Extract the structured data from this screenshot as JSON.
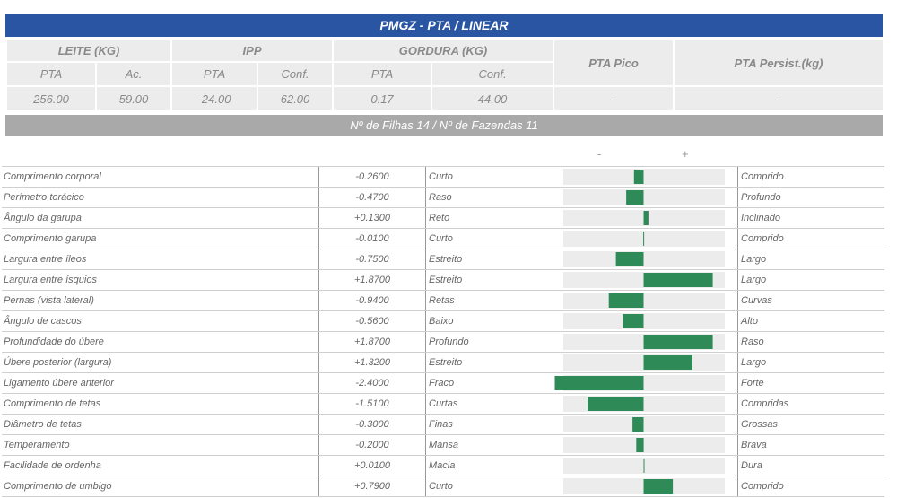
{
  "header": {
    "title": "PMGZ - PTA / LINEAR",
    "groups": {
      "leite": "LEITE (KG)",
      "ipp": "IPP",
      "gordura": "GORDURA (KG)",
      "pico": "PTA Pico",
      "persist": "PTA Persist.(kg)"
    },
    "sub": {
      "leite_pta": "PTA",
      "leite_ac": "Ac.",
      "ipp_pta": "PTA",
      "ipp_conf": "Conf.",
      "gord_pta": "PTA",
      "gord_conf": "Conf."
    },
    "values": {
      "leite_pta": "256.00",
      "leite_ac": "59.00",
      "ipp_pta": "-24.00",
      "ipp_conf": "62.00",
      "gord_pta": "0.17",
      "gord_conf": "44.00",
      "pico": "-",
      "persist": "-"
    },
    "filhas": "Nº de Filhas 14 / Nº de Fazendas 11"
  },
  "axis_signs": {
    "neg": "-",
    "pos": "+"
  },
  "colors": {
    "bar": "#2e8b57",
    "track": "#ececec",
    "title": "#2a55a3",
    "banner": "#a9a9a9"
  },
  "chart_data": {
    "type": "bar",
    "orientation": "horizontal",
    "xlim": [
      -2.4,
      2.4
    ],
    "categories": [
      "Comprimento corporal",
      "Perímetro torácico",
      "Ângulo da garupa",
      "Comprimento garupa",
      "Largura entre íleos",
      "Largura entre ísquios",
      "Pernas (vista lateral)",
      "Ângulo de cascos",
      "Profundidade do úbere",
      "Úbere posterior (largura)",
      "Ligamento úbere anterior",
      "Comprimento de tetas",
      "Diâmetro de tetas",
      "Temperamento",
      "Facilidade de ordenha",
      "Comprimento de umbigo"
    ],
    "values": [
      -0.26,
      -0.47,
      0.13,
      -0.01,
      -0.75,
      1.87,
      -0.94,
      -0.56,
      1.87,
      1.32,
      -2.4,
      -1.51,
      -0.3,
      -0.2,
      0.01,
      0.79
    ],
    "value_labels": [
      "-0.2600",
      "-0.4700",
      "+0.1300",
      "-0.0100",
      "-0.7500",
      "+1.8700",
      "-0.9400",
      "-0.5600",
      "+1.8700",
      "+1.3200",
      "-2.4000",
      "-1.5100",
      "-0.3000",
      "-0.2000",
      "+0.0100",
      "+0.7900"
    ],
    "low_labels": [
      "Curto",
      "Raso",
      "Reto",
      "Curto",
      "Estreito",
      "Estreito",
      "Retas",
      "Baixo",
      "Profundo",
      "Estreito",
      "Fraco",
      "Curtas",
      "Finas",
      "Mansa",
      "Macia",
      "Curto"
    ],
    "high_labels": [
      "Comprido",
      "Profundo",
      "Inclinado",
      "Comprido",
      "Largo",
      "Largo",
      "Curvas",
      "Alto",
      "Raso",
      "Largo",
      "Forte",
      "Compridas",
      "Grossas",
      "Brava",
      "Dura",
      "Comprido"
    ]
  }
}
